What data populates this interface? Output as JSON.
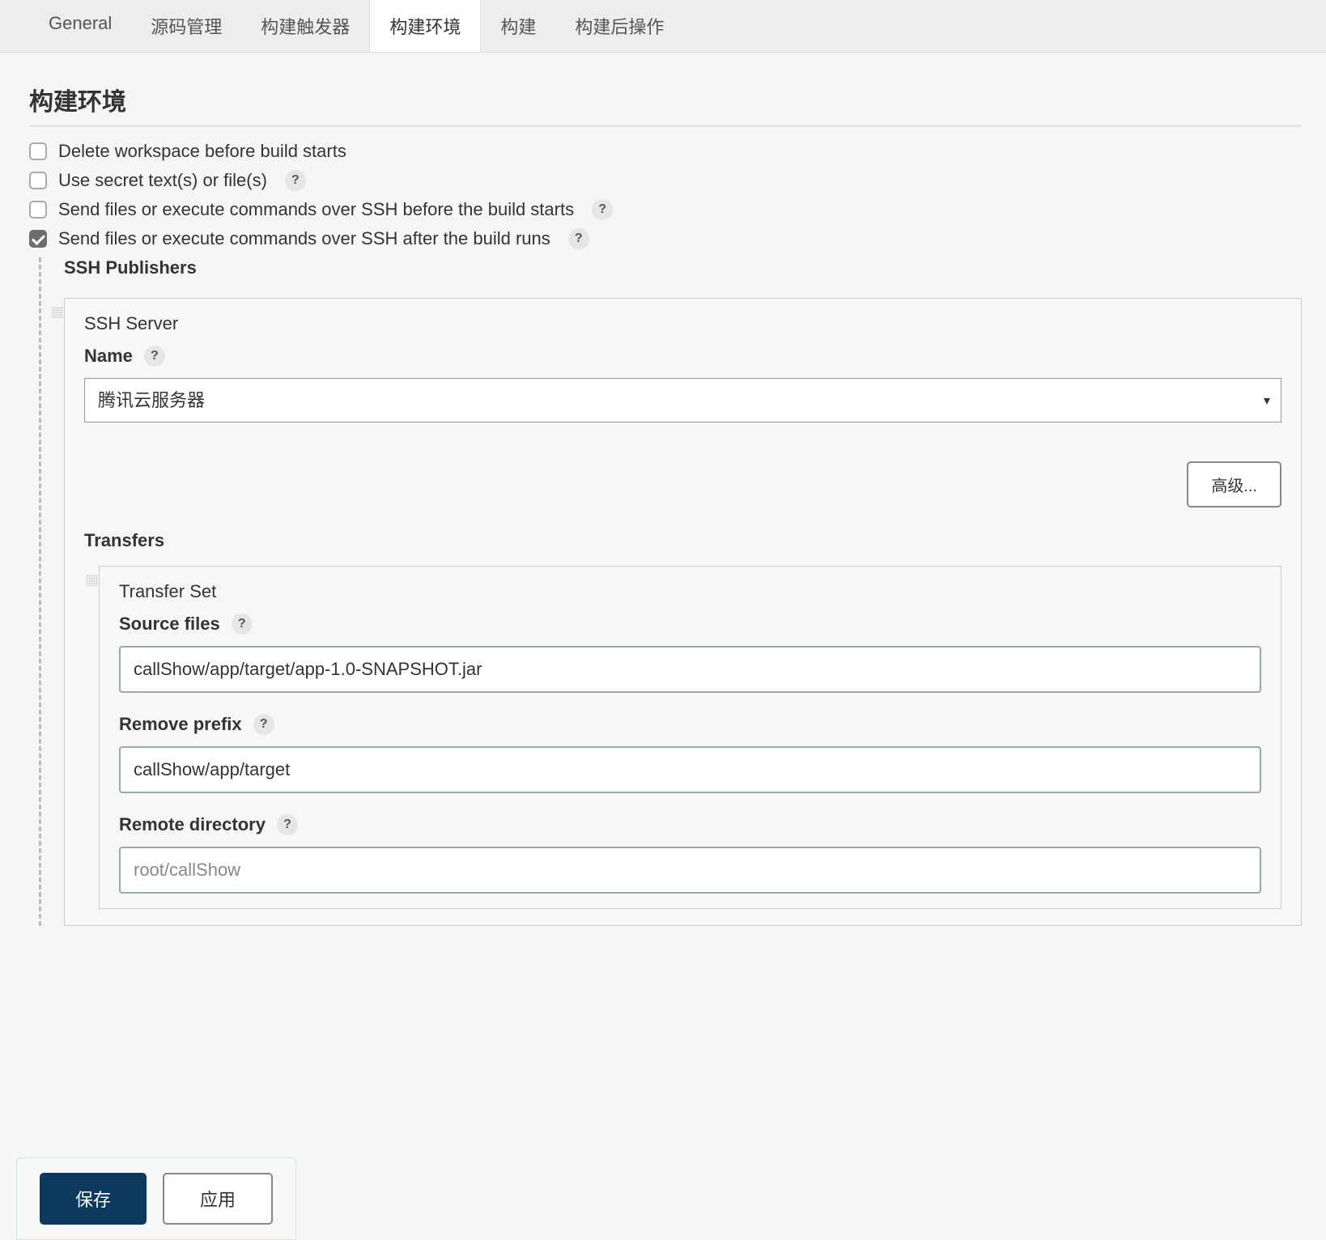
{
  "tabs": {
    "general": "General",
    "scm": "源码管理",
    "triggers": "构建触发器",
    "env": "构建环境",
    "build": "构建",
    "postbuild": "构建后操作"
  },
  "section_title": "构建环境",
  "checks": {
    "delete_ws": "Delete workspace before build starts",
    "secret": "Use secret text(s) or file(s)",
    "ssh_before": "Send files or execute commands over SSH before the build starts",
    "ssh_after": "Send files or execute commands over SSH after the build runs"
  },
  "ssh_publishers": "SSH Publishers",
  "ssh_server": {
    "title": "SSH Server",
    "name_label": "Name",
    "selected": "腾讯云服务器",
    "advanced_btn": "高级..."
  },
  "transfers": {
    "heading": "Transfers",
    "set_title": "Transfer Set",
    "source_files_label": "Source files",
    "source_files_value": "callShow/app/target/app-1.0-SNAPSHOT.jar",
    "remove_prefix_label": "Remove prefix",
    "remove_prefix_value": "callShow/app/target",
    "remote_dir_label": "Remote directory",
    "remote_dir_value": "root/callShow"
  },
  "help_glyph": "?",
  "buttons": {
    "save": "保存",
    "apply": "应用"
  }
}
